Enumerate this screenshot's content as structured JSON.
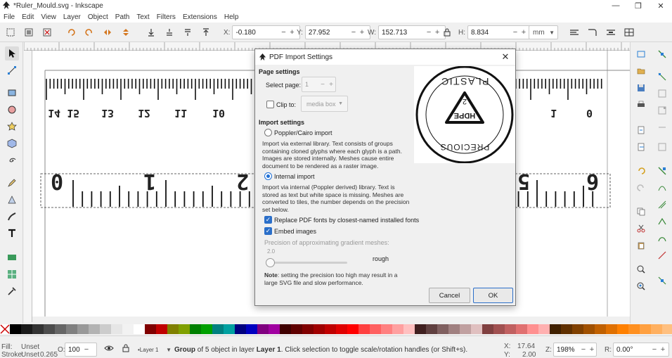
{
  "window": {
    "title": "*Ruler_Mould.svg - Inkscape"
  },
  "menu": [
    "File",
    "Edit",
    "View",
    "Layer",
    "Object",
    "Path",
    "Text",
    "Filters",
    "Extensions",
    "Help"
  ],
  "toolbar": {
    "x_label": "X:",
    "x_value": "-0.180",
    "y_label": "Y:",
    "y_value": "27.952",
    "w_label": "W:",
    "w_value": "152.713",
    "h_label": "H:",
    "h_value": "8.834",
    "unit": "mm",
    "minus": "−",
    "plus": "+"
  },
  "ruler_top_numbers": [
    "0",
    "1",
    "10",
    "11",
    "12",
    "13",
    "14 15"
  ],
  "ruler_mid_numbers": [
    "0",
    "1",
    "2",
    "5",
    "6"
  ],
  "dialog": {
    "title": "PDF Import Settings",
    "close": "✕",
    "page_settings": "Page settings",
    "select_page_label": "Select page:",
    "select_page_value": "1",
    "clip_label": "Clip to:",
    "clip_value": "media box",
    "import_settings": "Import settings",
    "poppler_label": "Poppler/Cairo import",
    "poppler_desc": "Import via external library. Text consists of groups containing cloned glyphs where each glyph is a path. Images are stored internally. Meshes cause entire document to be rendered as a raster image.",
    "internal_label": "Internal import",
    "internal_desc": "Import via internal (Poppler derived) library. Text is stored as text but white space is missing. Meshes are converted to tiles, the number depends on the precision set below.",
    "replace_fonts_label": "Replace PDF fonts by closest-named installed fonts",
    "embed_images_label": "Embed images",
    "precision_label": "Precision of approximating gradient meshes:",
    "precision_value": "2.0",
    "precision_fraction": 0.0,
    "rough_label": "rough",
    "note_bold": "Note",
    "note_text": ": setting the precision too high may result in a large SVG file and slow performance.",
    "cancel": "Cancel",
    "ok": "OK",
    "preview": {
      "top_text": "PRECIOUS",
      "bottom_text": "PLASTIC",
      "code": "HDPE",
      "number": "2"
    }
  },
  "palette": [
    "#000000",
    "#1a1a1a",
    "#333333",
    "#4d4d4d",
    "#666666",
    "#808080",
    "#999999",
    "#b3b3b3",
    "#cccccc",
    "#e6e6e6",
    "#f2f2f2",
    "#ffffff",
    "#800000",
    "#c00000",
    "#808000",
    "#80a000",
    "#008000",
    "#00a000",
    "#008080",
    "#00a0a0",
    "#000080",
    "#0000c0",
    "#800080",
    "#a000a0",
    "#400000",
    "#600000",
    "#800000",
    "#a00000",
    "#c00000",
    "#e00000",
    "#ff0000",
    "#ff4040",
    "#ff6060",
    "#ff8080",
    "#ffa0a0",
    "#ffc0c0",
    "#402020",
    "#604040",
    "#806060",
    "#a08080",
    "#c0a0a0",
    "#e0c0c0",
    "#804040",
    "#a05050",
    "#c06060",
    "#e07070",
    "#ff9090",
    "#ffb0b0",
    "#402000",
    "#603000",
    "#804000",
    "#a05000",
    "#c06000",
    "#e07000",
    "#ff8000",
    "#ff9020",
    "#ffa040",
    "#ffb060",
    "#ffc080",
    "#ffd0a0"
  ],
  "status": {
    "fill_label": "Fill:",
    "fill_value": "Unset",
    "stroke_label": "Stroke:",
    "stroke_value": "Unset",
    "stroke_width": "0.265",
    "opacity_label": "O:",
    "opacity_value": "100",
    "layer": "•Layer 1",
    "message_pre": "Group",
    "message_mid": " of 5 object in layer ",
    "message_layer": "Layer 1",
    "message_post": ". Click selection to toggle scale/rotation handles (or Shift+s).",
    "x_label": "X:",
    "x_value": "17.64",
    "y_label": "Y:",
    "y_value": "2.00",
    "z_label": "Z:",
    "zoom": "198%",
    "r_label": "R:",
    "rotation": "0.00°"
  }
}
